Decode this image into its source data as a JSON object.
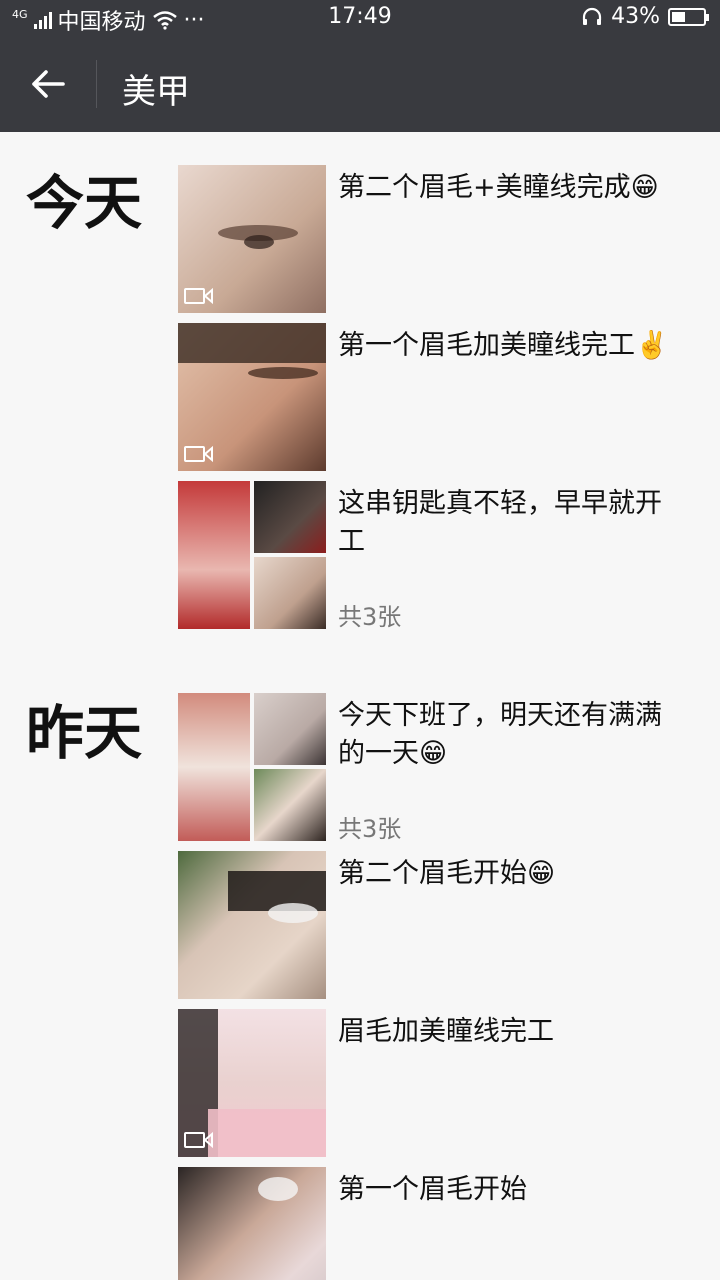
{
  "status_bar": {
    "network": "4G",
    "carrier": "中国移动",
    "dots": "···",
    "time": "17:49",
    "battery": "43%",
    "battery_level": 0.43
  },
  "header": {
    "title": "美甲"
  },
  "sections": [
    {
      "label": "今天",
      "items": [
        {
          "caption": "第二个眉毛+美瞳线完成😁",
          "count": "",
          "video": true
        },
        {
          "caption": "第一个眉毛加美瞳线完工✌️",
          "count": "",
          "video": true
        },
        {
          "caption": "这串钥匙真不轻，早早就开工",
          "count": "共3张",
          "video": false
        }
      ]
    },
    {
      "label": "昨天",
      "items": [
        {
          "caption": "今天下班了，明天还有满满的一天😁",
          "count": "共3张",
          "video": false
        },
        {
          "caption": "第二个眉毛开始😁",
          "count": "",
          "video": false
        },
        {
          "caption": "眉毛加美瞳线完工",
          "count": "",
          "video": true
        },
        {
          "caption": "第一个眉毛开始",
          "count": "",
          "video": false
        }
      ]
    }
  ],
  "colors": {
    "header_bg": "#393a3f",
    "page_bg": "#f7f7f7"
  }
}
